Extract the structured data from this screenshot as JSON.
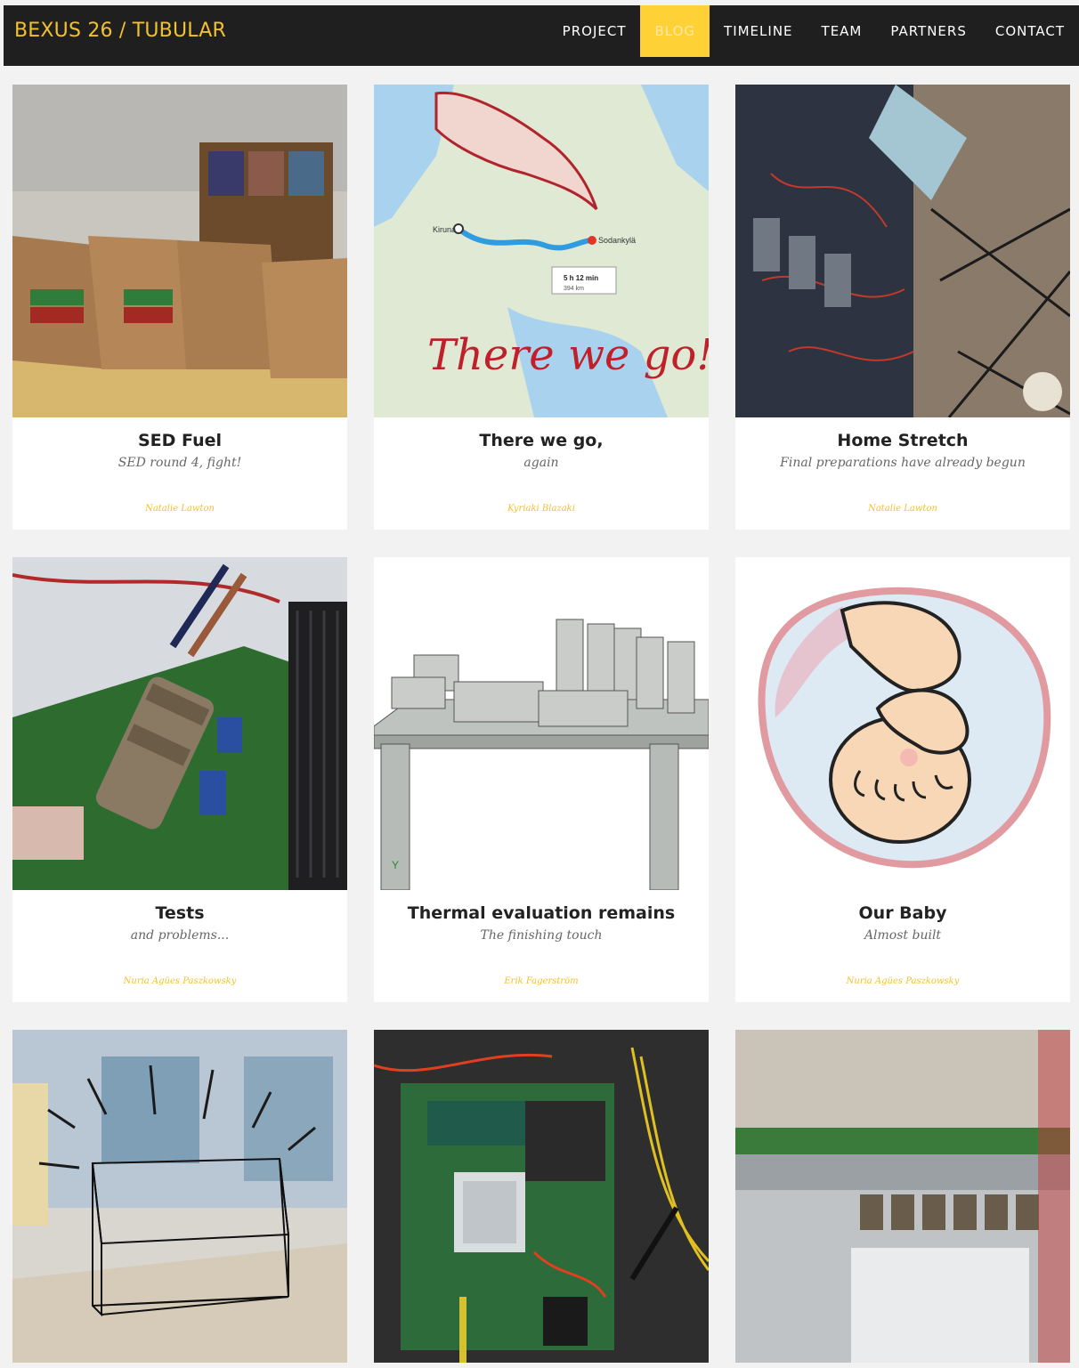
{
  "brand": "BEXUS 26 / TUBULAR",
  "nav": {
    "project": "PROJECT",
    "blog": "BLOG",
    "timeline": "TIMELINE",
    "team": "TEAM",
    "partners": "PARTNERS",
    "contact": "CONTACT"
  },
  "colors": {
    "accent": "#fed136",
    "navbar": "#1f1f1f",
    "author": "#f2c12e"
  },
  "posts": [
    {
      "title": "SED Fuel",
      "subtitle": "SED round 4, fight!",
      "author": "Natalie Lawton"
    },
    {
      "title": "There we go,",
      "subtitle": "again",
      "author": "Kyriaki Blazaki",
      "image_text": {
        "from": "Kiruna",
        "to": "Sodankylä",
        "duration": "5 h 12 min",
        "distance": "394 km",
        "slogan": "There we go!"
      }
    },
    {
      "title": "Home Stretch",
      "subtitle": "Final preparations have already begun",
      "author": "Natalie Lawton"
    },
    {
      "title": "Tests",
      "subtitle": "and problems...",
      "author": "Nuria Agües Paszkowsky"
    },
    {
      "title": "Thermal evaluation remains",
      "subtitle": "The finishing touch",
      "author": "Erik Fagerström"
    },
    {
      "title": "Our Baby",
      "subtitle": "Almost built",
      "author": "Nuria Agües Paszkowsky"
    }
  ]
}
